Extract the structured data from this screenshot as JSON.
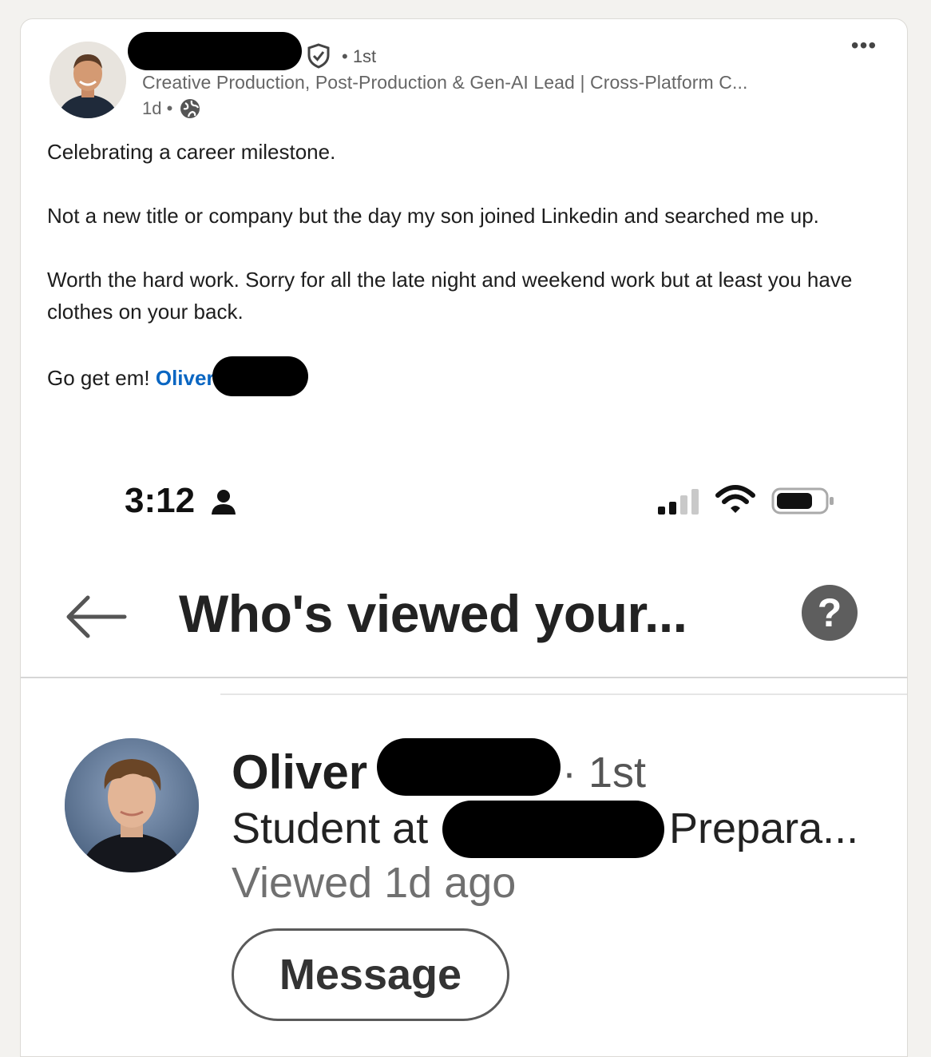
{
  "post": {
    "author": {
      "degree": "• 1st",
      "headline": "Creative Production, Post-Production & Gen-AI Lead | Cross-Platform C...",
      "time": "1d •"
    },
    "paragraphs": [
      "Celebrating a career milestone.",
      "Not a new title or company but the day my son joined Linkedin and searched me up.",
      "Worth the hard work. Sorry for all the late night and weekend work but at least you have clothes on your back."
    ],
    "closing_text": "Go get em! ",
    "mention": "Oliver",
    "more_label": "•••"
  },
  "screenshot": {
    "status_time": "3:12",
    "title": "Who's viewed your...",
    "help_label": "?",
    "viewer": {
      "name": "Oliver",
      "degree": "· 1st",
      "headline_start": "Student at",
      "headline_end": "Prepara...",
      "viewed": "Viewed 1d ago",
      "message_label": "Message"
    }
  },
  "icons": [
    "verified-shield-icon",
    "globe-icon",
    "person-status-icon",
    "signal-icon",
    "wifi-icon",
    "battery-icon",
    "back-arrow-icon",
    "help-icon"
  ],
  "colors": {
    "mention": "#0a66c2",
    "background": "#f3f2ef"
  }
}
